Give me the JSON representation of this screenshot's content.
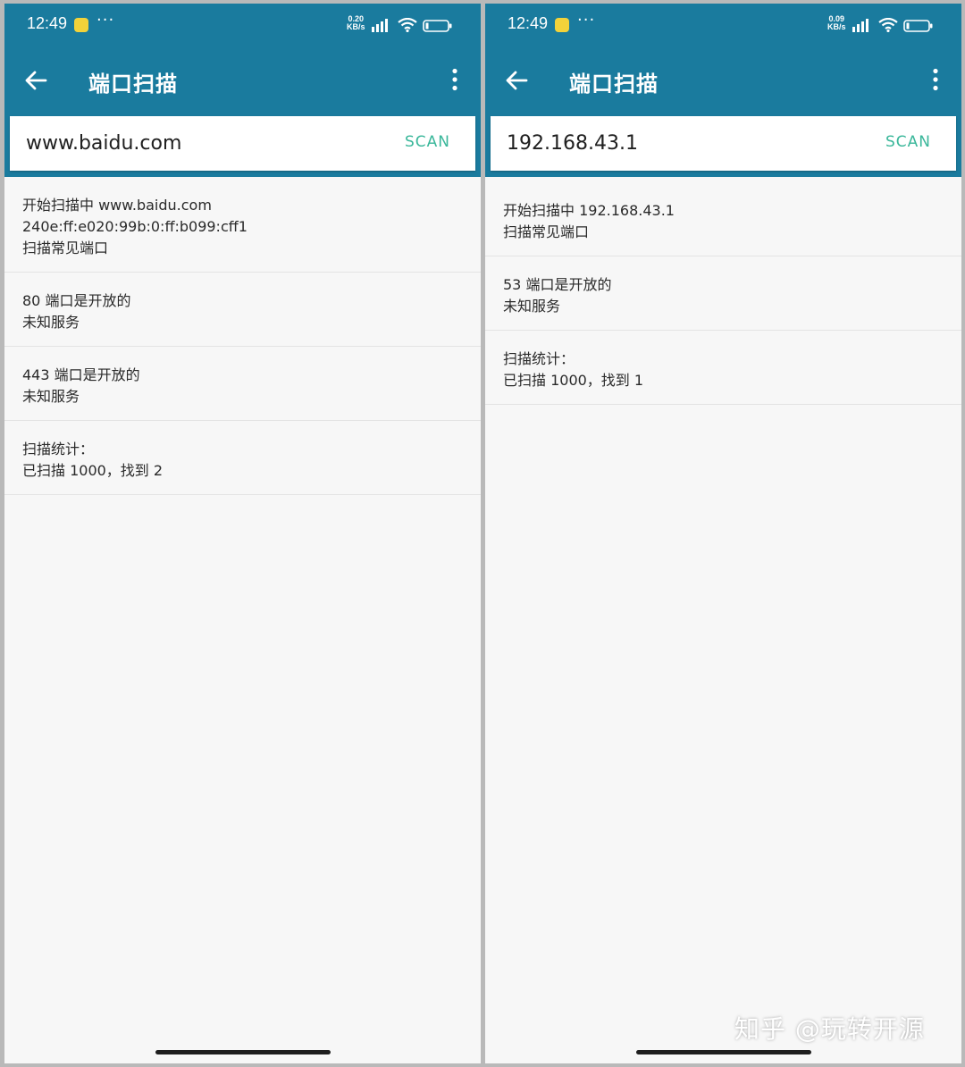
{
  "watermark": "知乎 @玩转开源",
  "screens": [
    {
      "status": {
        "time": "12:49",
        "speed_value": "0.20",
        "speed_unit": "KB/s"
      },
      "app_title": "端口扫描",
      "search": {
        "value": "www.baidu.com"
      },
      "scan_label": "SCAN",
      "results": [
        [
          "开始扫描中 www.baidu.com",
          "240e:ff:e020:99b:0:ff:b099:cff1",
          "扫描常见端口"
        ],
        [
          "80 端口是开放的",
          "未知服务"
        ],
        [
          "443 端口是开放的",
          "未知服务"
        ],
        [
          "扫描统计：",
          "已扫描 1000，找到 2"
        ]
      ]
    },
    {
      "status": {
        "time": "12:49",
        "speed_value": "0.09",
        "speed_unit": "KB/s"
      },
      "app_title": "端口扫描",
      "search": {
        "value": "192.168.43.1"
      },
      "scan_label": "SCAN",
      "results": [
        [
          "开始扫描中 192.168.43.1",
          "扫描常见端口"
        ],
        [
          "53 端口是开放的",
          "未知服务"
        ],
        [
          "扫描统计：",
          "已扫描 1000，找到 1"
        ]
      ]
    }
  ]
}
